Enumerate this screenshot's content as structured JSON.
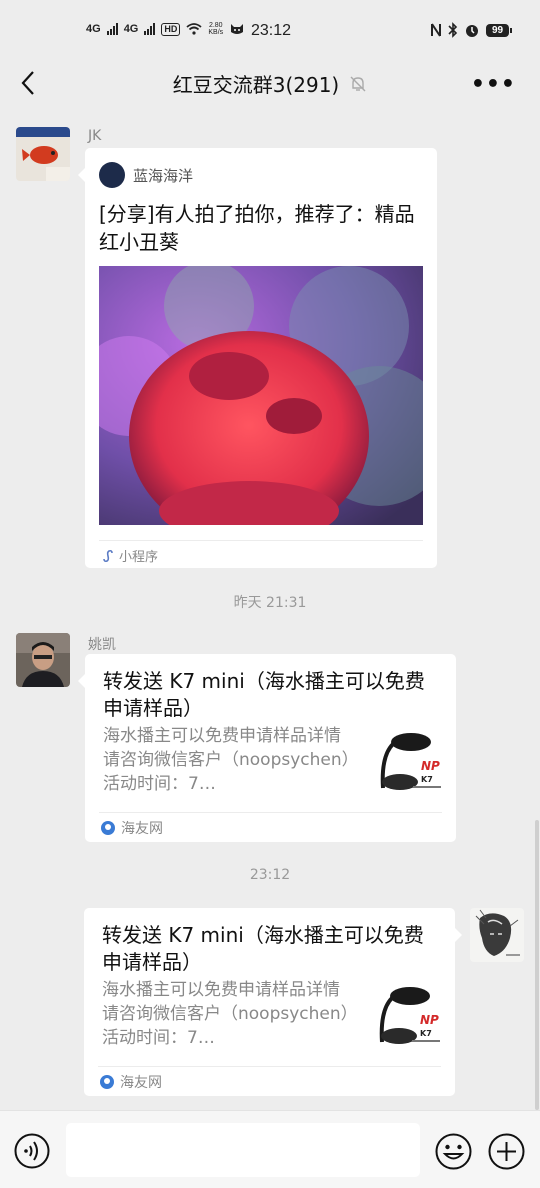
{
  "status_bar": {
    "signal1": "4G",
    "signal2": "4G",
    "hd": "HD",
    "speed_value": "2.80",
    "speed_unit": "KB/s",
    "time": "23:12",
    "battery": "99"
  },
  "header": {
    "title": "红豆交流群3(291)",
    "more": "•••"
  },
  "messages": {
    "m1": {
      "sender": "JK",
      "source": "蓝海海洋",
      "title": "[分享]有人拍了拍你，推荐了：精品红小丑葵",
      "footer": "小程序"
    },
    "time1": "昨天  21:31",
    "m2": {
      "sender": "姚凯",
      "title": "转发送 K7 mini（海水播主可以免费申请样品）",
      "desc": "海水播主可以免费申请样品详情请咨询微信客户（noopsychen）活动时间：7…",
      "site": "海友网"
    },
    "time2": "23:12",
    "m3": {
      "title": "转发送 K7 mini（海水播主可以免费申请样品）",
      "desc": "海水播主可以免费申请样品详情请咨询微信客户（noopsychen）活动时间：7…",
      "site": "海友网"
    }
  },
  "input": {
    "placeholder": ""
  },
  "colors": {
    "background": "#ededed",
    "card": "#ffffff",
    "meta_text": "#888888"
  }
}
